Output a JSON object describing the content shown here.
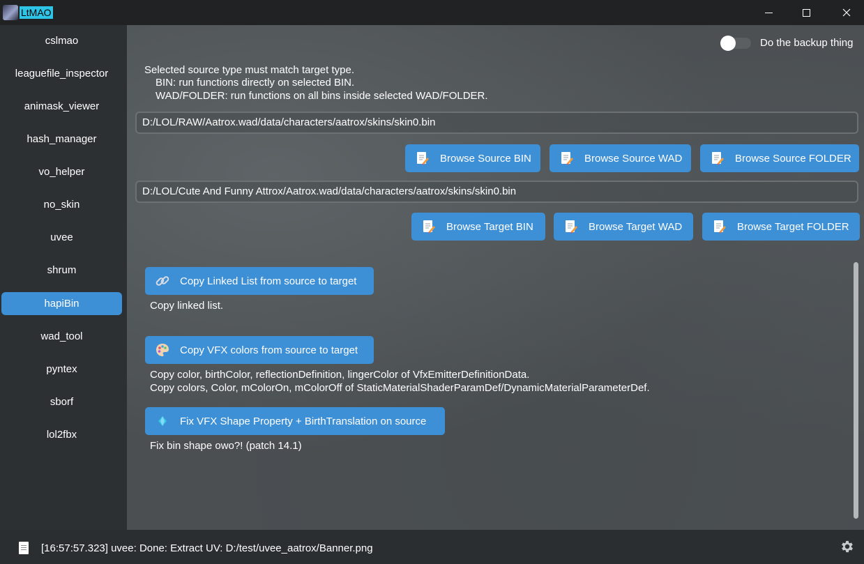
{
  "window": {
    "title": "LtMAO",
    "controls": [
      "minimize-icon",
      "maximize-icon",
      "close-icon"
    ]
  },
  "sidebar": {
    "items": [
      {
        "label": "cslmao"
      },
      {
        "label": "leaguefile_inspector"
      },
      {
        "label": "animask_viewer"
      },
      {
        "label": "hash_manager"
      },
      {
        "label": "vo_helper"
      },
      {
        "label": "no_skin"
      },
      {
        "label": "uvee"
      },
      {
        "label": "shrum"
      },
      {
        "label": "hapiBin",
        "active": true
      },
      {
        "label": "wad_tool"
      },
      {
        "label": "pyntex"
      },
      {
        "label": "sborf"
      },
      {
        "label": "lol2fbx"
      }
    ],
    "active_color": "#3d8fd6"
  },
  "main": {
    "backup_toggle": {
      "label": "Do the backup thing",
      "on": false
    },
    "info": {
      "line1": "Selected source type must match target type.",
      "line2": "BIN: run functions directly on selected BIN.",
      "line3": "WAD/FOLDER: run functions on all bins inside selected WAD/FOLDER."
    },
    "source_path": "D:/LOL/RAW/Aatrox.wad/data/characters/aatrox/skins/skin0.bin",
    "target_path": "D:/LOL/Cute And Funny Attrox/Aatrox.wad/data/characters/aatrox/skins/skin0.bin",
    "source_buttons": {
      "bin": "Browse Source BIN",
      "wad": "Browse Source WAD",
      "folder": "Browse Source FOLDER"
    },
    "target_buttons": {
      "bin": "Browse Target BIN",
      "wad": "Browse Target WAD",
      "folder": "Browse Target FOLDER"
    },
    "actions": {
      "linked": {
        "label": "Copy Linked List from source to target",
        "desc": "Copy linked list."
      },
      "vfx_colors": {
        "label": "Copy VFX colors from source to target",
        "desc1": "Copy color, birthColor, reflectionDefinition, lingerColor of VfxEmitterDefinitionData.",
        "desc2": "Copy colors, Color, mColorOn, mColorOff of StaticMaterialShaderParamDef/DynamicMaterialParameterDef."
      },
      "fix_shape": {
        "label": "Fix VFX Shape Property + BirthTranslation on source",
        "desc": "Fix bin shape owo?! (patch 14.1)"
      }
    },
    "button_color": "#3d8fd6"
  },
  "statusbar": {
    "message": "[16:57:57.323] uvee: Done: Extract UV: D:/test/uvee_aatrox/Banner.png",
    "icons": [
      "document-icon",
      "gear-icon"
    ]
  }
}
